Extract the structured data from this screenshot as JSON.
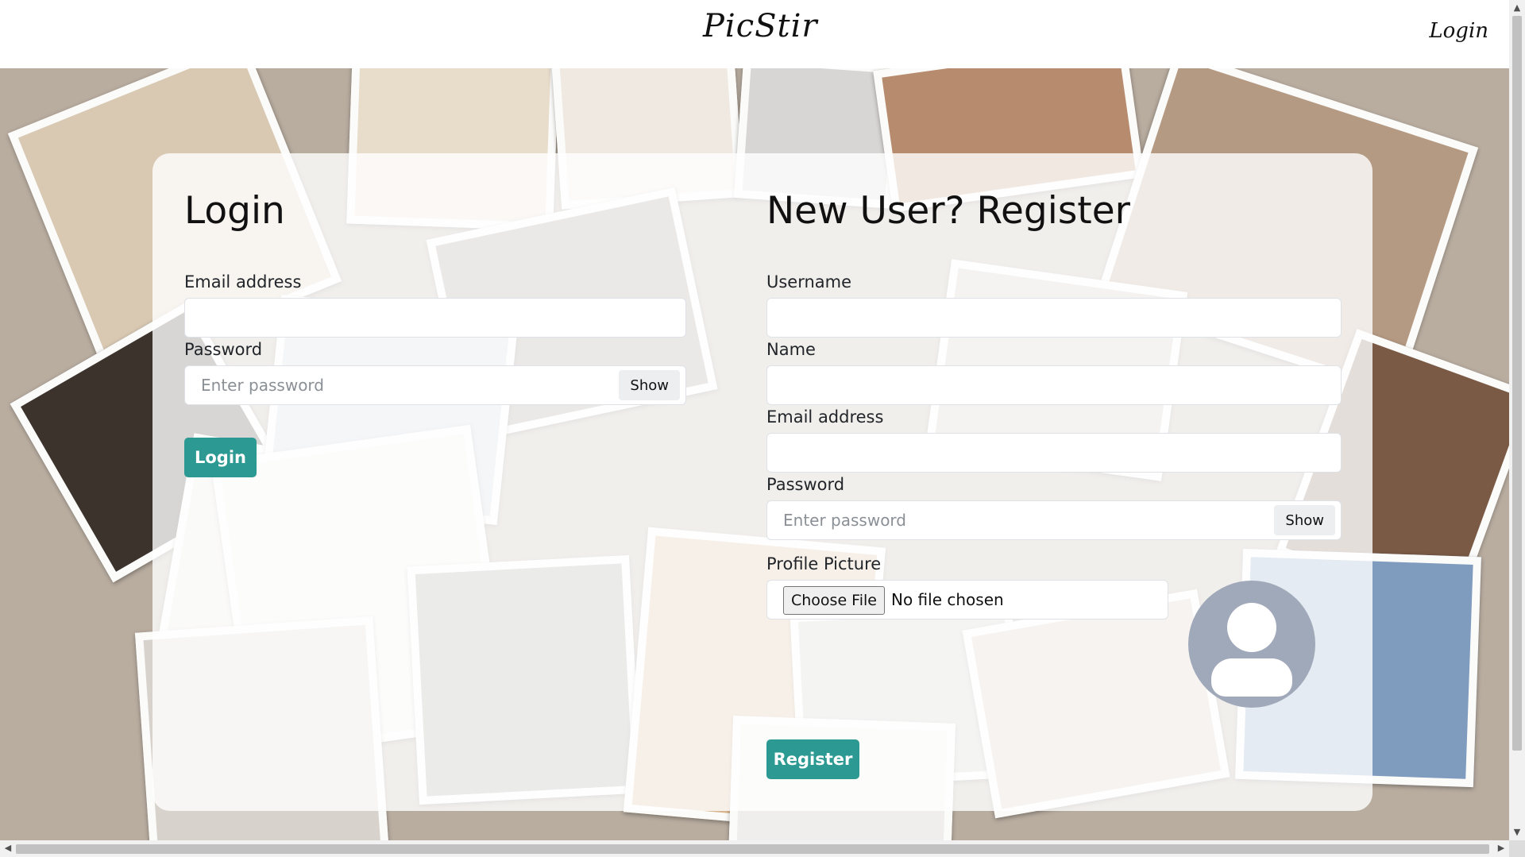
{
  "app": {
    "brand": "PicStir",
    "nav_login": "Login"
  },
  "login": {
    "title": "Login",
    "email_label": "Email address",
    "email_value": "",
    "password_label": "Password",
    "password_placeholder": "Enter password",
    "show_label": "Show",
    "submit_label": "Login"
  },
  "register": {
    "title": "New User? Register",
    "username_label": "Username",
    "username_value": "",
    "name_label": "Name",
    "name_value": "",
    "email_label": "Email address",
    "email_value": "",
    "password_label": "Password",
    "password_placeholder": "Enter password",
    "show_label": "Show",
    "picture_label": "Profile Picture",
    "choose_file_label": "Choose File",
    "file_status": "No file chosen",
    "submit_label": "Register"
  },
  "icons": {
    "avatar": "default-user-avatar-icon"
  },
  "colors": {
    "accent": "#2c9a92",
    "avatar_bg": "#a0a9b9",
    "card_bg": "rgba(255,255,255,0.80)"
  }
}
